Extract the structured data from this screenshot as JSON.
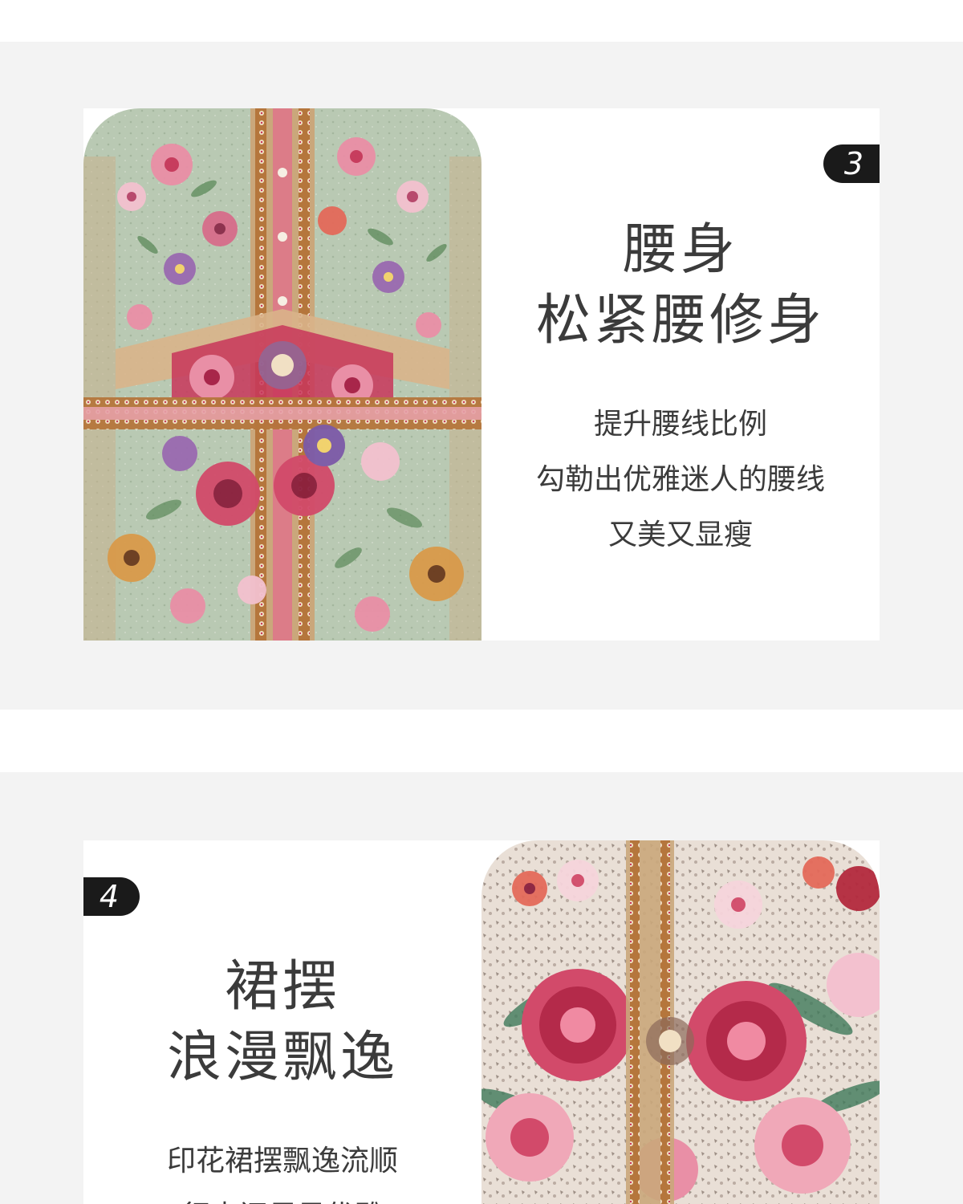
{
  "sections": [
    {
      "number": "3",
      "title_line1": "腰身",
      "title_line2": "松紧腰修身",
      "desc_lines": [
        "提升腰线比例",
        "勾勒出优雅迷人的腰线",
        "又美又显瘦"
      ],
      "photo": "floral-dress-waist-photo"
    },
    {
      "number": "4",
      "title_line1": "裙摆",
      "title_line2": "浪漫飘逸",
      "desc_lines": [
        "印花裙摆飘逸流顺",
        "行走间尽显优雅"
      ],
      "photo": "floral-dress-hem-photo"
    }
  ],
  "colors": {
    "background": "#f3f3f3",
    "card": "#ffffff",
    "badge": "#1a1a1a",
    "text": "#3b3b3b",
    "fabric_mint": "#b9c9b3",
    "rose": "#c8365a",
    "pink": "#e98fa6",
    "gold_trim": "#b5763c"
  }
}
